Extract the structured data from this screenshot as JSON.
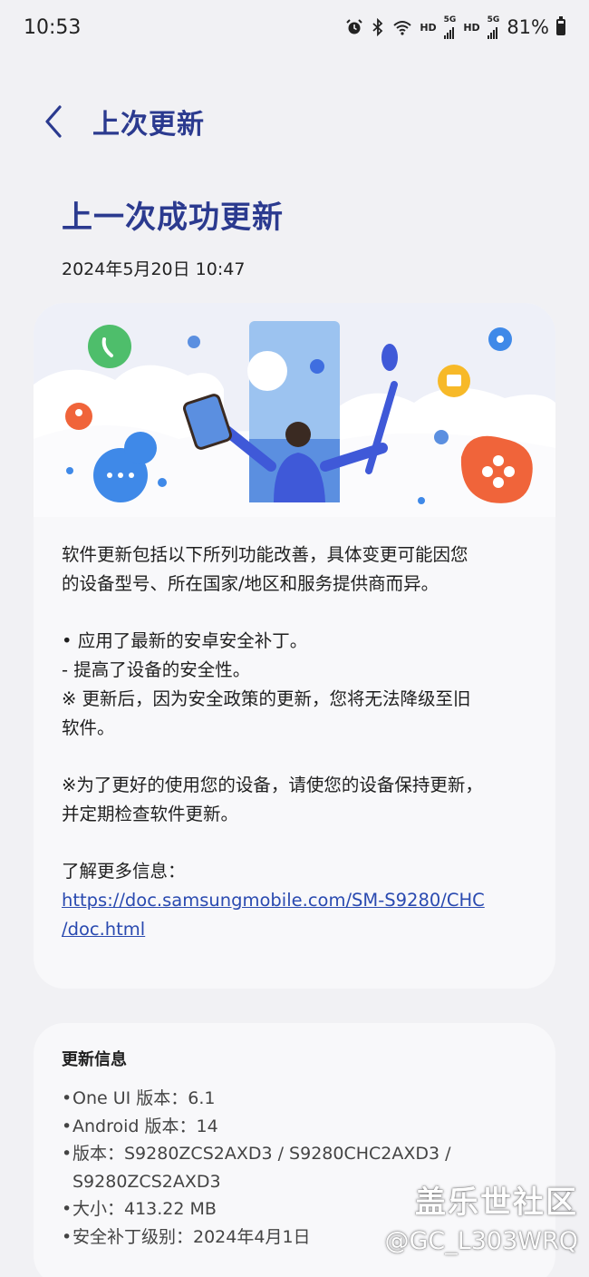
{
  "status_bar": {
    "time": "10:53",
    "hd_1": "HD",
    "net_1": "5G",
    "hd_2": "HD",
    "net_2": "5G",
    "battery": "81%",
    "icons": [
      "alarm-icon",
      "bluetooth-icon",
      "wifi-icon",
      "signal-icon",
      "battery-icon"
    ]
  },
  "header": {
    "title": "上次更新",
    "back_icon": "chevron-left-icon"
  },
  "main": {
    "title": "上一次成功更新",
    "date": "2024年5月20日 10:47"
  },
  "card": {
    "intro_line_1": "软件更新包括以下所列功能改善，具体变更可能因您",
    "intro_line_2": "的设备型号、所在国家/地区和服务提供商而异。",
    "bullet_1": "• 应用了最新的安卓安全补丁。",
    "bullet_1_sub": " - 提高了设备的安全性。",
    "note_line_1": "※ 更新后，因为安全政策的更新，您将无法降级至旧",
    "note_line_2": "软件。",
    "advice_line_1": "※为了更好的使用您的设备，请使您的设备保持更新，",
    "advice_line_2": "并定期检查软件更新。",
    "more_info_label": "了解更多信息：",
    "link_line_1": "https://doc.samsungmobile.com/SM-S9280/CHC",
    "link_line_2": "/doc.html"
  },
  "info": {
    "title": "更新信息",
    "items": [
      {
        "text": "One UI 版本：6.1"
      },
      {
        "text": "Android 版本：14"
      },
      {
        "text": "版本：S9280ZCS2AXD3 / S9280CHC2AXD3 /"
      },
      {
        "text": "S9280ZCS2AXD3"
      },
      {
        "text": "大小：413.22 MB"
      },
      {
        "text": "安全补丁级别：2024年4月1日"
      }
    ]
  },
  "watermark": {
    "line_1": "盖乐世社区",
    "line_2": "@GC_L303WRQ"
  },
  "colors": {
    "accent": "#2b3a8f",
    "link": "#2a4ab0",
    "background": "#f1f1f4",
    "card": "#f8f8fa"
  }
}
